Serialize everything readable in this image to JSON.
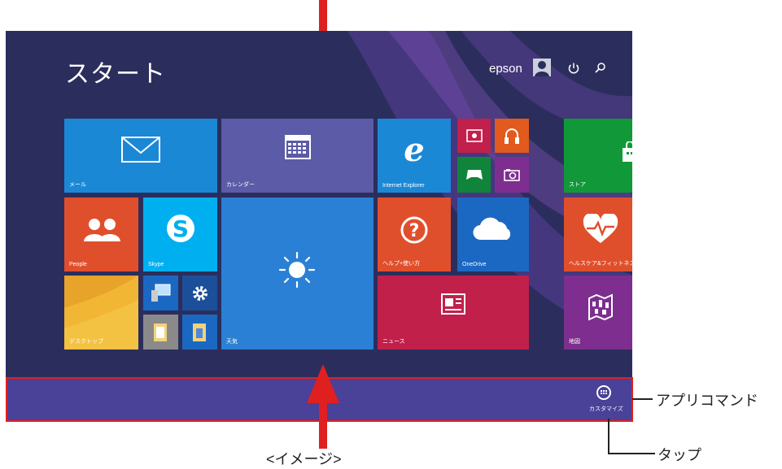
{
  "screen": {
    "title": "スタート",
    "user_name": "epson"
  },
  "tiles": [
    {
      "id": "mail",
      "label": "メール"
    },
    {
      "id": "calendar",
      "label": "カレンダー"
    },
    {
      "id": "ie",
      "label": "Internet Explorer"
    },
    {
      "id": "store",
      "label": "ストア"
    },
    {
      "id": "people",
      "label": "People"
    },
    {
      "id": "skype",
      "label": "Skype"
    },
    {
      "id": "weather",
      "label": "天気"
    },
    {
      "id": "help",
      "label": "ヘルプ+使い方"
    },
    {
      "id": "onedrive",
      "label": "OneDrive"
    },
    {
      "id": "health",
      "label": "ヘルスケア&フィットネス"
    },
    {
      "id": "desktop",
      "label": "デスクトップ"
    },
    {
      "id": "news",
      "label": "ニュース"
    },
    {
      "id": "maps",
      "label": "地図"
    }
  ],
  "appbar": {
    "customize_label": "カスタマイズ"
  },
  "annotations": {
    "appbar_label": "アプリコマンド",
    "tap_label": "タップ",
    "caption": "<イメージ>"
  },
  "colors": {
    "background": "#2b2e5c",
    "appbar": "#4a4198",
    "highlight": "#e02020"
  }
}
